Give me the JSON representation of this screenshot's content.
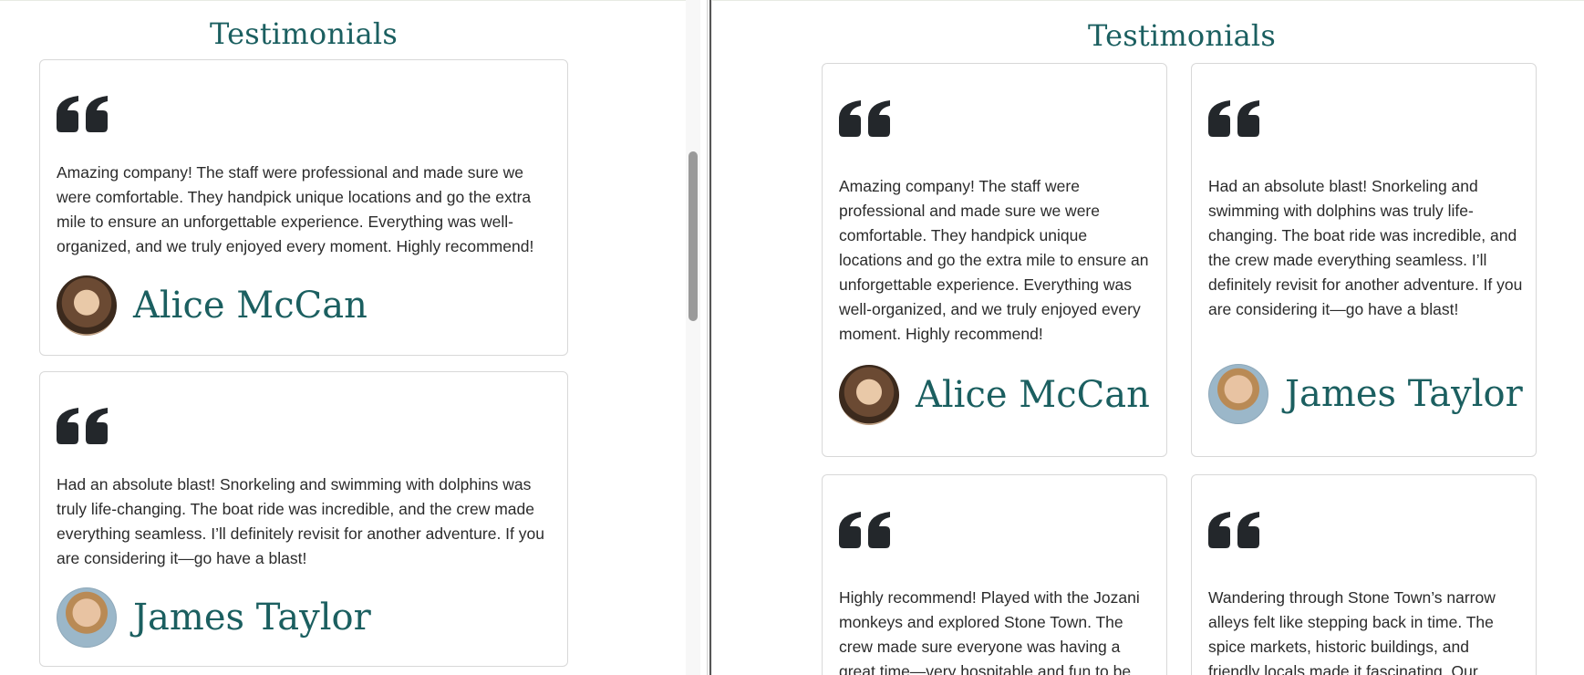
{
  "section": {
    "title": "Testimonials"
  },
  "colors": {
    "accent": "#1b5f60",
    "text": "#2b2b2b",
    "card_border": "#d8d8d8",
    "quote_icon": "#23272b"
  },
  "testimonials": [
    {
      "text": "Amazing company! The staff were professional and made sure we were comfortable. They handpick unique locations and go the extra mile to ensure an unforgettable experience. Everything was well-organized, and we truly enjoyed every moment. Highly recommend!",
      "author": "Alice McCan",
      "icon": "quote-icon",
      "avatar_icon": "avatar-photo"
    },
    {
      "text": "Had an absolute blast! Snorkeling and swimming with dolphins was truly life-changing. The boat ride was incredible, and the crew made everything seamless. I’ll definitely revisit for another adventure. If you are considering it—go have a blast!",
      "author": "James Taylor",
      "icon": "quote-icon",
      "avatar_icon": "avatar-photo"
    },
    {
      "text": "Highly recommend! Played with the Jozani monkeys and explored Stone Town. The crew made sure everyone was having a great time—very hospitable and fun to be",
      "icon": "quote-icon"
    },
    {
      "text": "Wandering through Stone Town’s narrow alleys felt like stepping back in time. The spice markets, historic buildings, and friendly locals made it fascinating. Our",
      "icon": "quote-icon"
    }
  ]
}
